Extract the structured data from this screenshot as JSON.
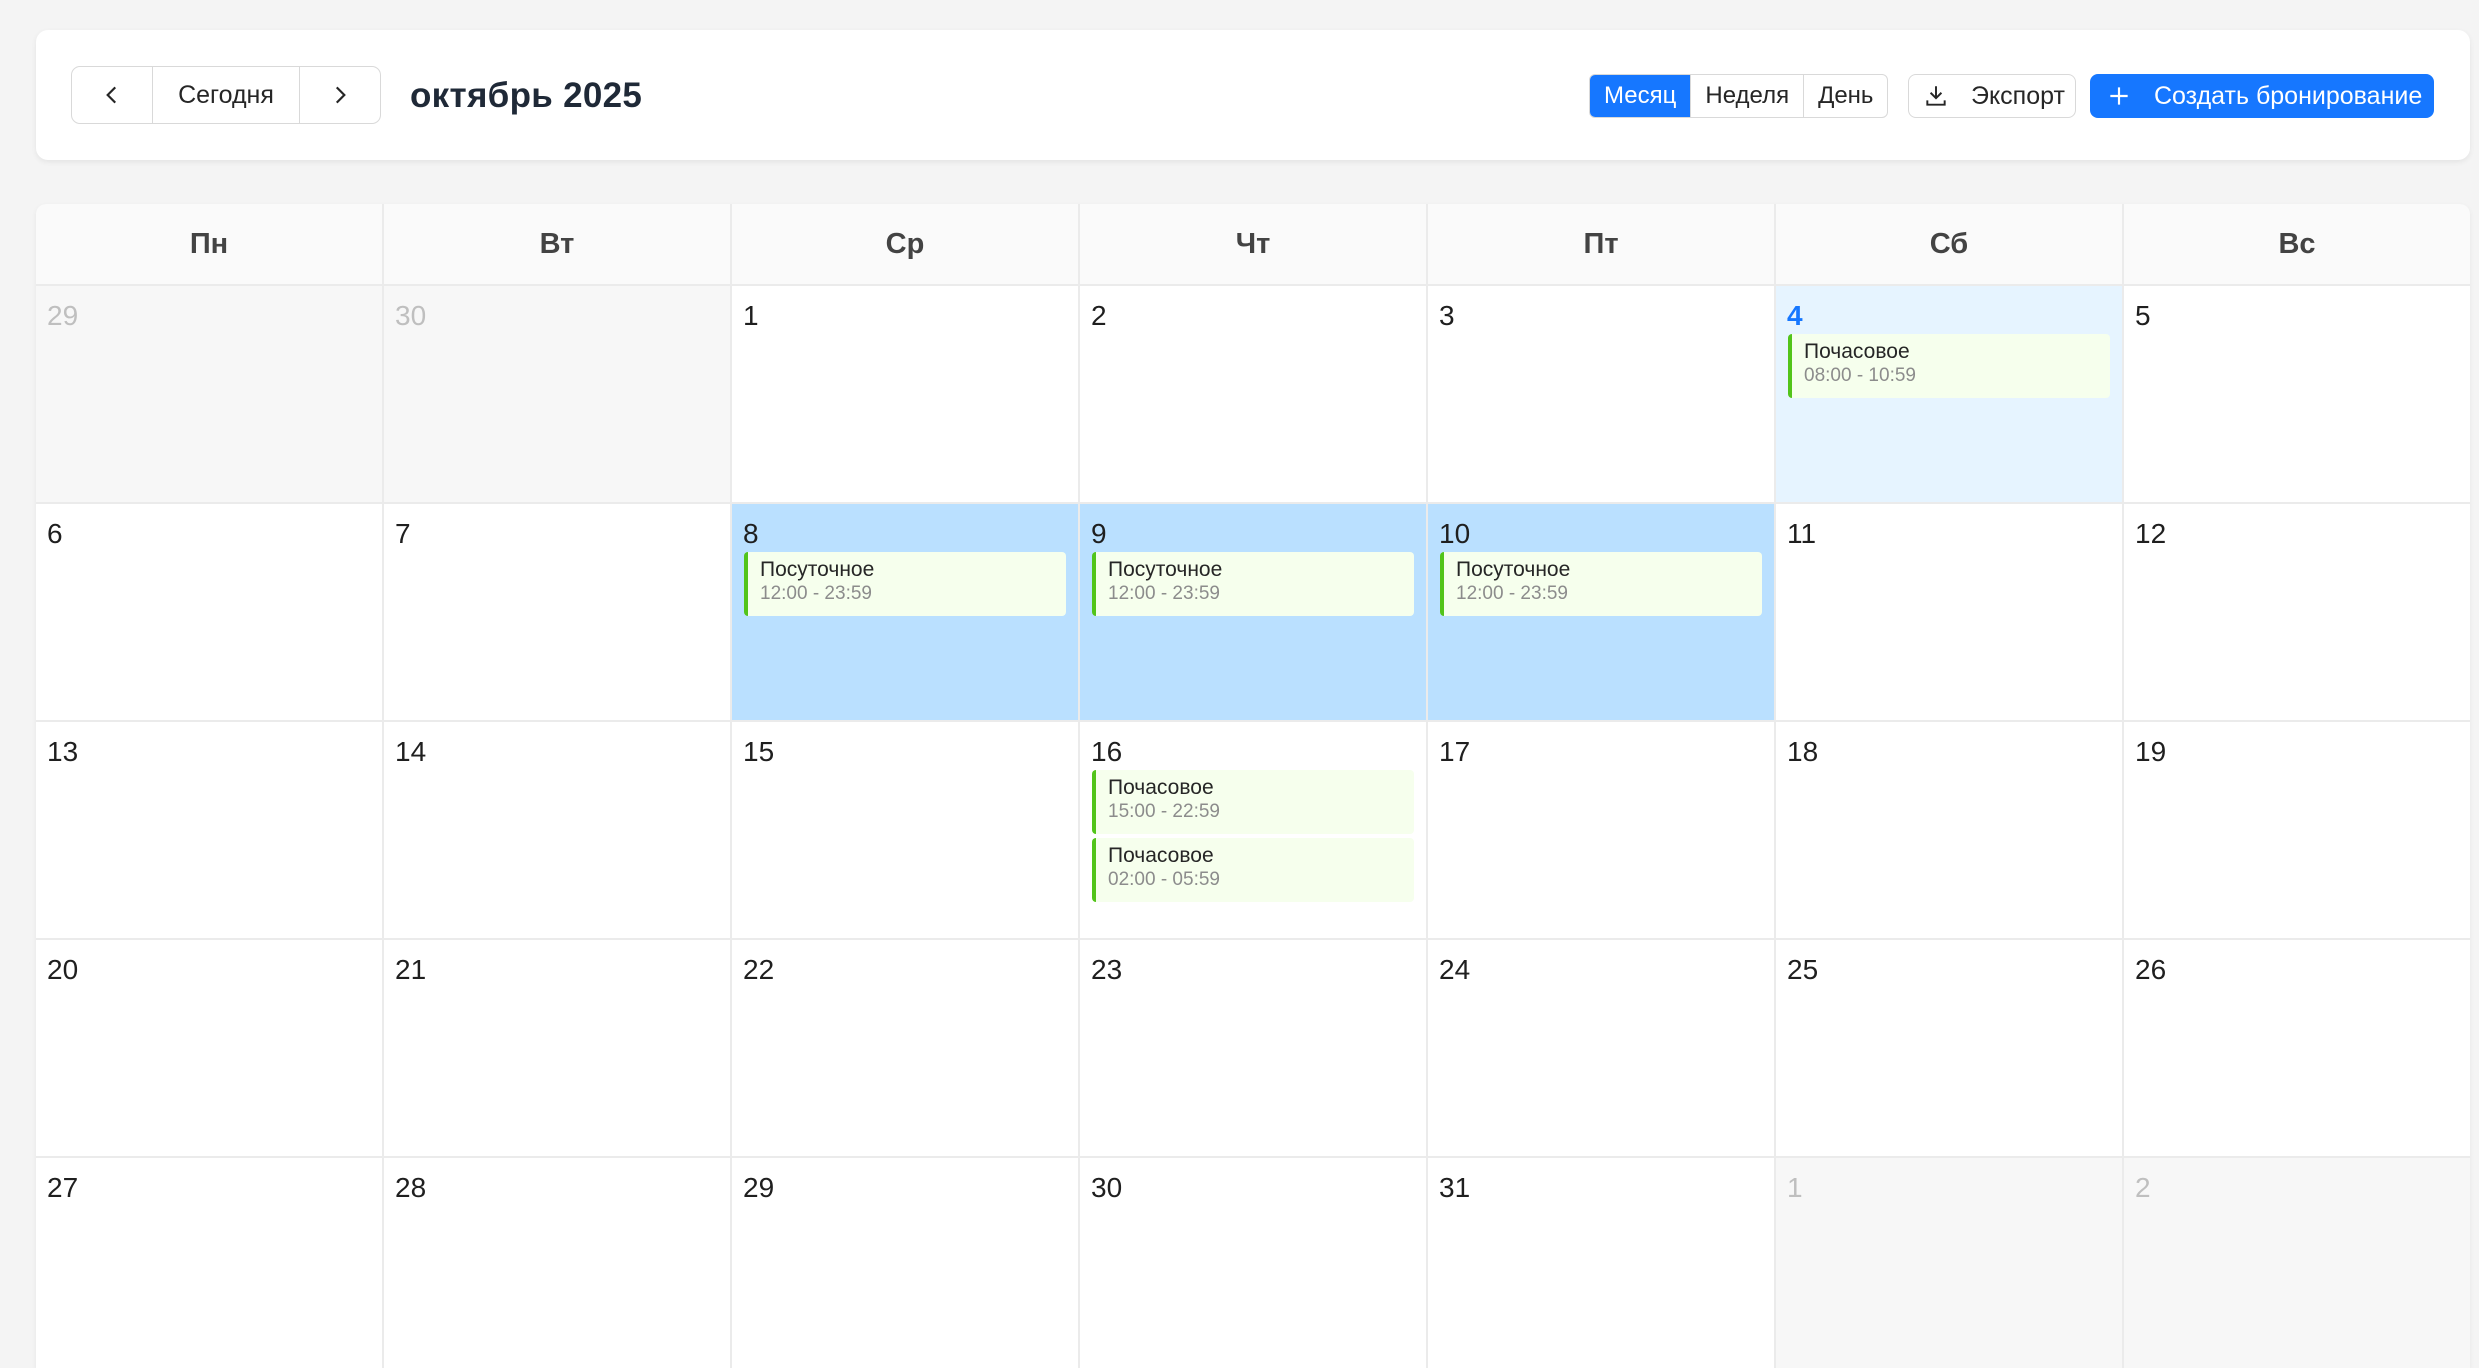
{
  "toolbar": {
    "prev_icon": "chevron-left-icon",
    "today_label": "Сегодня",
    "next_icon": "chevron-right-icon",
    "title": "октябрь 2025",
    "views": [
      {
        "label": "Месяц",
        "active": true
      },
      {
        "label": "Неделя",
        "active": false
      },
      {
        "label": "День",
        "active": false
      }
    ],
    "export_icon": "download-icon",
    "export_label": "Экспорт",
    "create_icon": "plus-icon",
    "create_label": "Создать бронирование"
  },
  "colors": {
    "primary": "#1677ff",
    "today_bg": "#e6f4ff",
    "booked_bg": "#bae0ff",
    "event_bg": "#f6ffed",
    "event_border": "#52c41a"
  },
  "calendar": {
    "weekdays": [
      "Пн",
      "Вт",
      "Ср",
      "Чт",
      "Пт",
      "Сб",
      "Вс"
    ],
    "weeks": [
      [
        {
          "day": "29",
          "state": "other"
        },
        {
          "day": "30",
          "state": "other"
        },
        {
          "day": "1"
        },
        {
          "day": "2"
        },
        {
          "day": "3"
        },
        {
          "day": "4",
          "state": "today",
          "events": [
            {
              "title": "Почасовое",
              "time": "08:00 - 10:59"
            }
          ]
        },
        {
          "day": "5"
        }
      ],
      [
        {
          "day": "6"
        },
        {
          "day": "7"
        },
        {
          "day": "8",
          "state": "booked",
          "events": [
            {
              "title": "Посуточное",
              "time": "12:00 - 23:59"
            }
          ]
        },
        {
          "day": "9",
          "state": "booked",
          "events": [
            {
              "title": "Посуточное",
              "time": "12:00 - 23:59"
            }
          ]
        },
        {
          "day": "10",
          "state": "booked",
          "events": [
            {
              "title": "Посуточное",
              "time": "12:00 - 23:59"
            }
          ]
        },
        {
          "day": "11"
        },
        {
          "day": "12"
        }
      ],
      [
        {
          "day": "13"
        },
        {
          "day": "14"
        },
        {
          "day": "15"
        },
        {
          "day": "16",
          "events": [
            {
              "title": "Почасовое",
              "time": "15:00 - 22:59"
            },
            {
              "title": "Почасовое",
              "time": "02:00 - 05:59"
            }
          ]
        },
        {
          "day": "17"
        },
        {
          "day": "18"
        },
        {
          "day": "19"
        }
      ],
      [
        {
          "day": "20"
        },
        {
          "day": "21"
        },
        {
          "day": "22"
        },
        {
          "day": "23"
        },
        {
          "day": "24"
        },
        {
          "day": "25"
        },
        {
          "day": "26"
        }
      ],
      [
        {
          "day": "27"
        },
        {
          "day": "28"
        },
        {
          "day": "29"
        },
        {
          "day": "30"
        },
        {
          "day": "31"
        },
        {
          "day": "1",
          "state": "other"
        },
        {
          "day": "2",
          "state": "other"
        }
      ]
    ]
  }
}
